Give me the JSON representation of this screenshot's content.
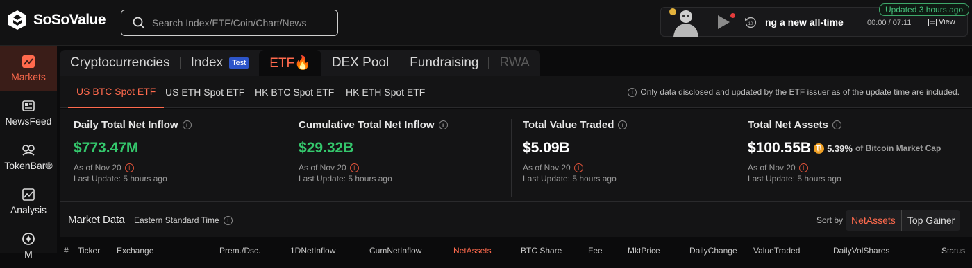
{
  "brand": {
    "name": "SoSoValue"
  },
  "search": {
    "placeholder": "Search Index/ETF/Coin/Chart/News"
  },
  "player": {
    "title": "ng a new all-time",
    "time": "00:00 / 07:11",
    "view_label": "View",
    "updated_badge": "Updated 3 hours ago"
  },
  "sidebar": {
    "items": [
      {
        "label": "Markets",
        "icon": "chart-trend-icon"
      },
      {
        "label": "NewsFeed",
        "icon": "newspaper-icon"
      },
      {
        "label": "TokenBar®",
        "icon": "tokenbar-icon"
      },
      {
        "label": "Analysis",
        "icon": "analysis-icon"
      },
      {
        "label": "M",
        "icon": "compass-icon"
      }
    ]
  },
  "tabs": [
    {
      "label": "Cryptocurrencies"
    },
    {
      "label": "Index",
      "badge": "Test"
    },
    {
      "label": "ETF🔥"
    },
    {
      "label": "DEX Pool"
    },
    {
      "label": "Fundraising"
    },
    {
      "label": "RWA"
    }
  ],
  "subtabs": [
    {
      "label": "US BTC Spot ETF"
    },
    {
      "label": "US ETH Spot ETF"
    },
    {
      "label": "HK BTC Spot ETF"
    },
    {
      "label": "HK ETH Spot ETF"
    }
  ],
  "notice": "Only data disclosed and updated by the ETF issuer as of the update time are included.",
  "stats": [
    {
      "label": "Daily Total Net Inflow",
      "value": "$773.47M",
      "as_of": "As of Nov 20",
      "update": "Last Update: 5 hours ago"
    },
    {
      "label": "Cumulative Total Net Inflow",
      "value": "$29.32B",
      "as_of": "As of Nov 20",
      "update": "Last Update: 5 hours ago"
    },
    {
      "label": "Total Value Traded",
      "value": "$5.09B",
      "as_of": "As of Nov 20",
      "update": "Last Update: 5 hours ago"
    },
    {
      "label": "Total Net Assets",
      "value": "$100.55B",
      "pct": "5.39%",
      "pct_note": "of Bitcoin Market Cap",
      "as_of": "As of Nov 20",
      "update": "Last Update: 5 hours ago"
    }
  ],
  "market": {
    "title": "Market Data",
    "timezone": "Eastern Standard Time",
    "sort_label": "Sort by",
    "sort_options": [
      "NetAssets",
      "Top Gainer"
    ]
  },
  "table_headers": [
    "#",
    "Ticker",
    "Exchange",
    "Prem./Dsc.",
    "1DNetInflow",
    "CumNetInflow",
    "NetAssets",
    "BTC Share",
    "Fee",
    "MktPrice",
    "DailyChange",
    "ValueTraded",
    "DailyVolShares",
    "Status"
  ],
  "colors": {
    "accent": "#ff6a4d",
    "positive": "#34c76c",
    "badge": "#2d55c9"
  }
}
